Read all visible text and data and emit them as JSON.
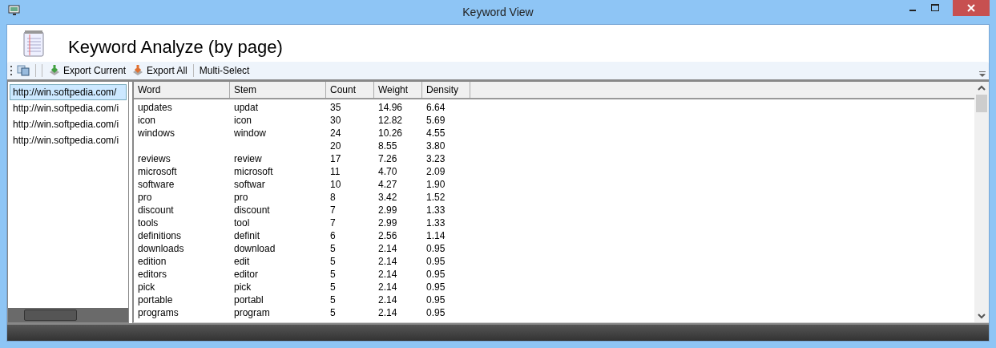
{
  "window": {
    "title": "Keyword View"
  },
  "header": {
    "title": "Keyword Analyze (by page)"
  },
  "toolbar": {
    "buttons": [
      {
        "kind": "copy"
      },
      {
        "kind": "export-current",
        "label": "Export Current"
      },
      {
        "kind": "export-all",
        "label": "Export All"
      },
      {
        "kind": "text",
        "label": "Multi-Select"
      }
    ]
  },
  "pages": [
    {
      "url": "http://win.softpedia.com/",
      "selected": true
    },
    {
      "url": "http://win.softpedia.com/i",
      "selected": false
    },
    {
      "url": "http://win.softpedia.com/i",
      "selected": false
    },
    {
      "url": "http://win.softpedia.com/i",
      "selected": false
    }
  ],
  "table": {
    "columns": [
      "Word",
      "Stem",
      "Count",
      "Weight",
      "Density"
    ],
    "rows": [
      {
        "word": "updates",
        "stem": "updat",
        "count": "35",
        "weight": "14.96",
        "density": "6.64"
      },
      {
        "word": "icon",
        "stem": "icon",
        "count": "30",
        "weight": "12.82",
        "density": "5.69"
      },
      {
        "word": "windows",
        "stem": "window",
        "count": "24",
        "weight": "10.26",
        "density": "4.55"
      },
      {
        "count": "20",
        "weight": "8.55",
        "density": "3.80"
      },
      {
        "word": "reviews",
        "stem": "review",
        "count": "17",
        "weight": "7.26",
        "density": "3.23"
      },
      {
        "word": "microsoft",
        "stem": "microsoft",
        "count": "11",
        "weight": "4.70",
        "density": "2.09"
      },
      {
        "word": "software",
        "stem": "softwar",
        "count": "10",
        "weight": "4.27",
        "density": "1.90"
      },
      {
        "word": "pro",
        "stem": "pro",
        "count": "8",
        "weight": "3.42",
        "density": "1.52"
      },
      {
        "word": "discount",
        "stem": "discount",
        "count": "7",
        "weight": "2.99",
        "density": "1.33"
      },
      {
        "word": "tools",
        "stem": "tool",
        "count": "7",
        "weight": "2.99",
        "density": "1.33"
      },
      {
        "word": "definitions",
        "stem": "definit",
        "count": "6",
        "weight": "2.56",
        "density": "1.14"
      },
      {
        "word": "downloads",
        "stem": "download",
        "count": "5",
        "weight": "2.14",
        "density": "0.95"
      },
      {
        "word": "edition",
        "stem": "edit",
        "count": "5",
        "weight": "2.14",
        "density": "0.95"
      },
      {
        "word": "editors",
        "stem": "editor",
        "count": "5",
        "weight": "2.14",
        "density": "0.95"
      },
      {
        "word": "pick",
        "stem": "pick",
        "count": "5",
        "weight": "2.14",
        "density": "0.95"
      },
      {
        "word": "portable",
        "stem": "portabl",
        "count": "5",
        "weight": "2.14",
        "density": "0.95"
      },
      {
        "word": "programs",
        "stem": "program",
        "count": "5",
        "weight": "2.14",
        "density": "0.95"
      }
    ]
  }
}
